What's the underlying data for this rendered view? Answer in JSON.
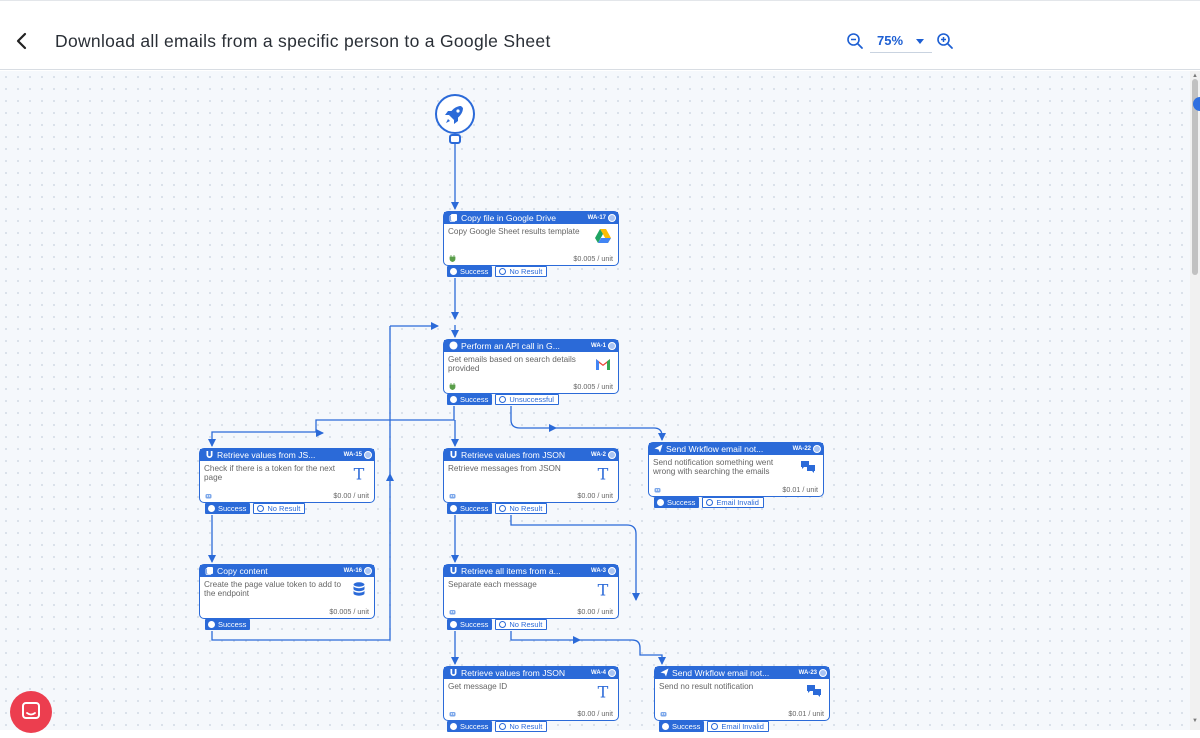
{
  "header": {
    "title": "Download all emails from a specific person to a Google Sheet",
    "zoom_value": "75%",
    "back_icon": "chevron-left-icon",
    "zoom_out_icon": "zoom-out-icon",
    "zoom_in_icon": "zoom-in-icon"
  },
  "start": {
    "icon": "rocket-icon"
  },
  "colors": {
    "accent": "#2b6ad8",
    "chat": "#ec3e4f"
  },
  "nodes": [
    {
      "title": "Copy file in Google Drive",
      "id": "WA-17",
      "desc": "Copy Google Sheet results template",
      "cost": "$0.005 / unit",
      "app_icon": "google-drive-icon",
      "header_icon": "copy-icon",
      "foot_icon": "plug-icon",
      "outputs": [
        {
          "label": "Success"
        },
        {
          "label": "No Result"
        }
      ]
    },
    {
      "title": "Perform an API call in G...",
      "id": "WA-1",
      "desc": "Get emails based on search details provided",
      "cost": "$0.005 / unit",
      "app_icon": "gmail-icon",
      "header_icon": "api-icon",
      "foot_icon": "plug-icon",
      "outputs": [
        {
          "label": "Success"
        },
        {
          "label": "Unsuccessful"
        }
      ]
    },
    {
      "title": "Retrieve values from JS...",
      "id": "WA-15",
      "desc": "Check if there is a token for the next page",
      "cost": "$0.00 / unit",
      "app_icon": "text-tool-icon",
      "header_icon": "magnet-icon",
      "foot_icon": "robot-icon",
      "outputs": [
        {
          "label": "Success"
        },
        {
          "label": "No Result"
        }
      ]
    },
    {
      "title": "Retrieve values from JSON",
      "id": "WA-2",
      "desc": "Retrieve messages from JSON",
      "cost": "$0.00 / unit",
      "app_icon": "text-tool-icon",
      "header_icon": "magnet-icon",
      "foot_icon": "robot-icon",
      "outputs": [
        {
          "label": "Success"
        },
        {
          "label": "No Result"
        }
      ]
    },
    {
      "title": "Send Wrkflow email not...",
      "id": "WA-22",
      "desc": "Send notification something went wrong with searching the emails",
      "cost": "$0.01 / unit",
      "app_icon": "chat-bubbles-icon",
      "header_icon": "send-icon",
      "foot_icon": "robot-icon",
      "outputs": [
        {
          "label": "Success"
        },
        {
          "label": "Email Invalid"
        }
      ]
    },
    {
      "title": "Copy content",
      "id": "WA-16",
      "desc": "Create the page value token to add to the endpoint",
      "cost": "$0.005 / unit",
      "app_icon": "database-icon",
      "header_icon": "copy-icon",
      "foot_icon": "",
      "outputs": [
        {
          "label": "Success"
        }
      ]
    },
    {
      "title": "Retrieve all items from a...",
      "id": "WA-3",
      "desc": "Separate each message",
      "cost": "$0.00 / unit",
      "app_icon": "text-tool-icon",
      "header_icon": "magnet-icon",
      "foot_icon": "robot-icon",
      "outputs": [
        {
          "label": "Success"
        },
        {
          "label": "No Result"
        }
      ]
    },
    {
      "title": "Retrieve values from JSON",
      "id": "WA-4",
      "desc": "Get message ID",
      "cost": "$0.00 / unit",
      "app_icon": "text-tool-icon",
      "header_icon": "magnet-icon",
      "foot_icon": "robot-icon",
      "outputs": [
        {
          "label": "Success"
        },
        {
          "label": "No Result"
        }
      ]
    },
    {
      "title": "Send Wrkflow email not...",
      "id": "WA-23",
      "desc": "Send no result notification",
      "cost": "$0.01 / unit",
      "app_icon": "chat-bubbles-icon",
      "header_icon": "send-icon",
      "foot_icon": "robot-icon",
      "outputs": [
        {
          "label": "Success"
        },
        {
          "label": "Email Invalid"
        }
      ]
    }
  ],
  "chat_widget": {
    "icon": "chat-icon"
  }
}
